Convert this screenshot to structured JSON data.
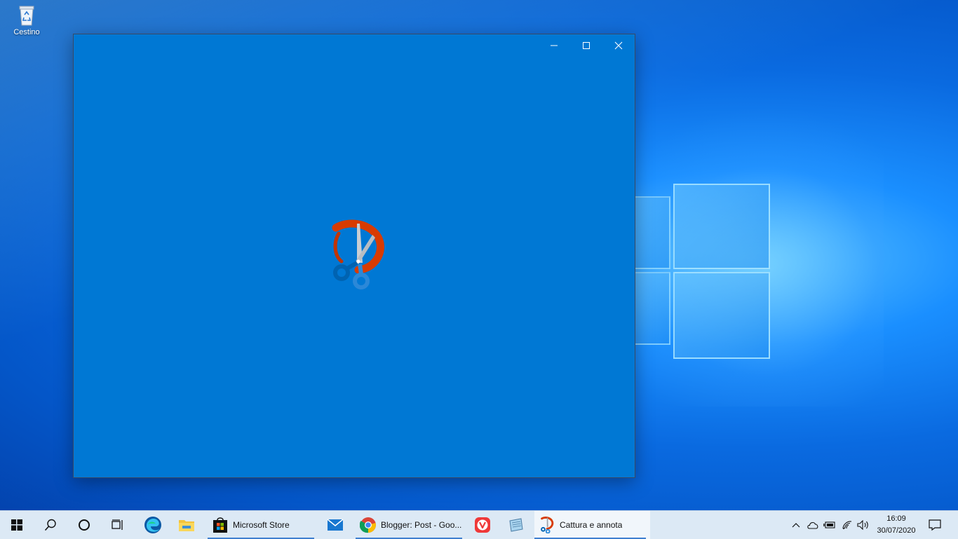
{
  "desktop": {
    "icons": [
      {
        "label": "Cestino",
        "icon": "recycle-bin-icon"
      }
    ]
  },
  "window": {
    "app": "Cattura e annota",
    "controls": {
      "minimize": "minimize-icon",
      "maximize": "maximize-icon",
      "close": "close-icon"
    },
    "splash_icon": "snip-sketch-icon"
  },
  "taskbar": {
    "pinned": [
      {
        "name": "start",
        "icon": "windows-start-icon"
      },
      {
        "name": "search",
        "icon": "search-icon"
      },
      {
        "name": "cortana",
        "icon": "cortana-icon"
      },
      {
        "name": "task-view",
        "icon": "task-view-icon"
      },
      {
        "name": "edge",
        "icon": "edge-icon"
      },
      {
        "name": "explorer",
        "icon": "folder-icon"
      }
    ],
    "apps": [
      {
        "label": "Microsoft Store",
        "icon": "store-icon"
      },
      {
        "label": "",
        "icon": "mail-icon"
      },
      {
        "label": "Blogger: Post - Goo...",
        "icon": "chrome-icon"
      },
      {
        "label": "",
        "icon": "vivaldi-icon"
      },
      {
        "label": "",
        "icon": "notepad-icon"
      },
      {
        "label": "Cattura e annota",
        "icon": "snip-sketch-icon"
      }
    ],
    "tray": {
      "icons": [
        "chevron-up-icon",
        "onedrive-icon",
        "battery-icon",
        "wifi-icon",
        "volume-icon"
      ],
      "time": "16:09",
      "date": "30/07/2020",
      "notification_icon": "notification-icon"
    }
  },
  "colors": {
    "window_bg": "#0078d4",
    "taskbar_bg": "#dce9f5",
    "accent": "#3f7fd0"
  }
}
